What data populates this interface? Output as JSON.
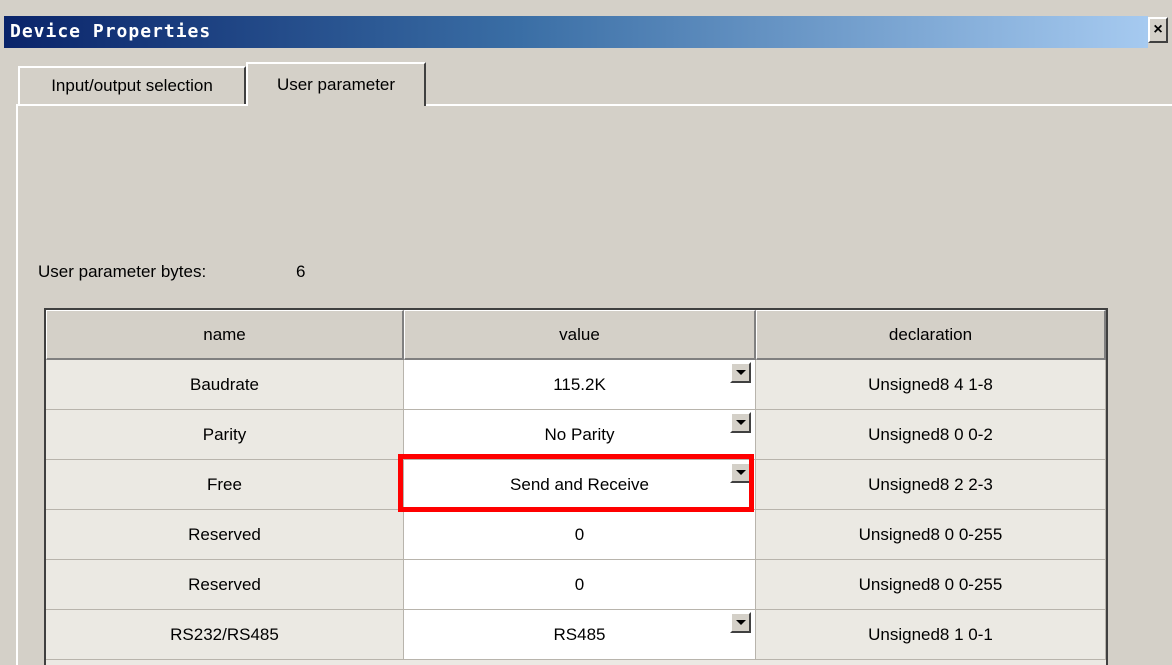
{
  "window": {
    "title": "Device Properties",
    "close_glyph": "×",
    "close_icon": "close-icon"
  },
  "tabs": [
    {
      "label": "Input/output selection",
      "active": false
    },
    {
      "label": "User parameter",
      "active": true
    }
  ],
  "user_parameter": {
    "bytes_label": "User parameter bytes:",
    "bytes_value": "6"
  },
  "grid": {
    "columns": [
      "name",
      "value",
      "declaration"
    ],
    "rows": [
      {
        "name": "Baudrate",
        "value": "115.2K",
        "declaration": "Unsigned8 4 1-8",
        "has_dropdown": true
      },
      {
        "name": "Parity",
        "value": "No Parity",
        "declaration": "Unsigned8 0 0-2",
        "has_dropdown": true
      },
      {
        "name": "Free",
        "value": "Send and Receive",
        "declaration": "Unsigned8 2 2-3",
        "has_dropdown": true
      },
      {
        "name": "Reserved",
        "value": "0",
        "declaration": "Unsigned8 0 0-255",
        "has_dropdown": false
      },
      {
        "name": "Reserved",
        "value": "0",
        "declaration": "Unsigned8 0 0-255",
        "has_dropdown": false
      },
      {
        "name": "RS232/RS485",
        "value": "RS485",
        "declaration": "Unsigned8 1 0-1",
        "has_dropdown": true
      }
    ],
    "dropdown_icon": "chevron-down-icon"
  },
  "colors": {
    "title_gradient_start": "#0a246a",
    "title_gradient_end": "#a6caf0",
    "dialog_face": "#d4d0c8",
    "highlight": "#ff0000"
  },
  "highlight": {
    "row": 2,
    "column": "value"
  }
}
